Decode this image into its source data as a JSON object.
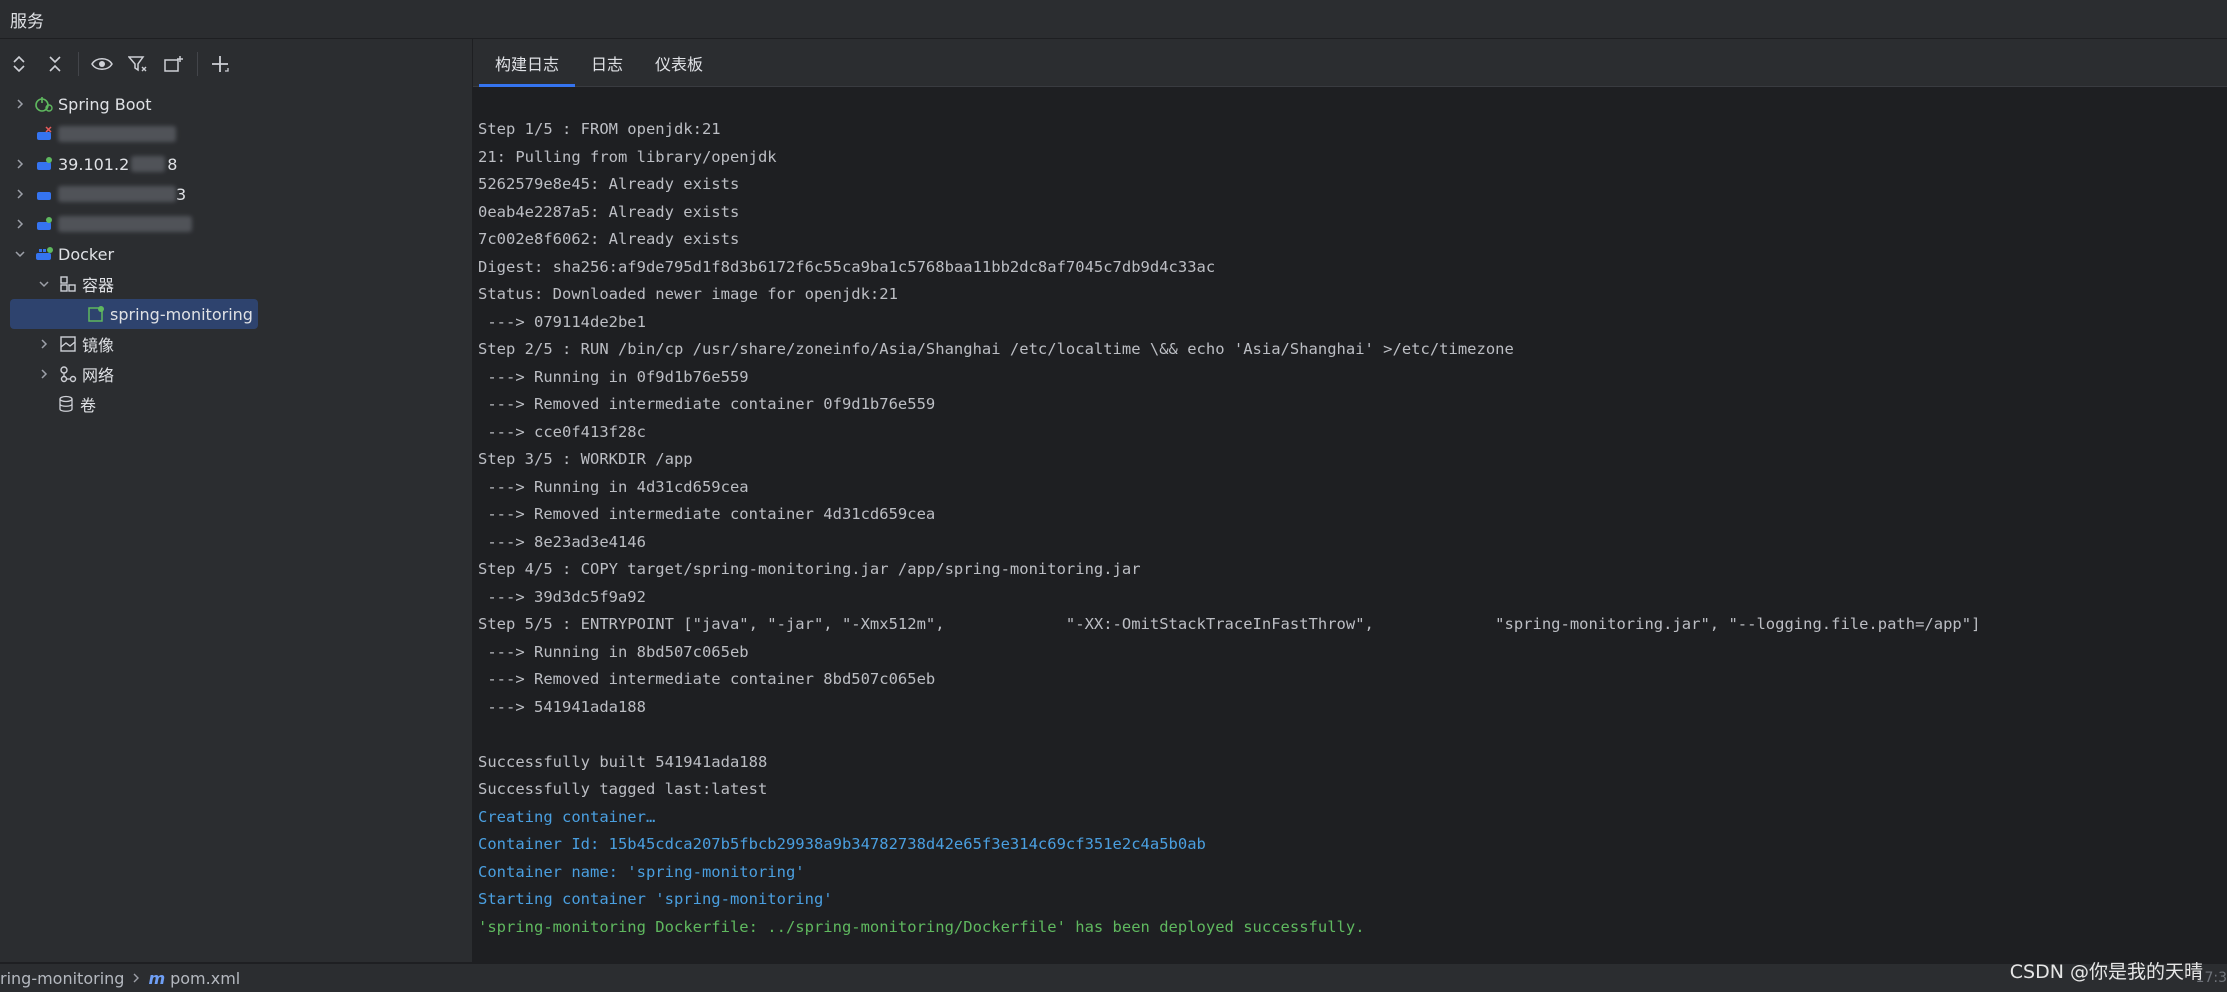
{
  "window": {
    "title": "服务"
  },
  "toolbar": {
    "buttons": [
      {
        "icon": "expand-all-icon",
        "glyph": "⌃"
      },
      {
        "icon": "collapse-all-icon",
        "glyph": "⌄"
      },
      {
        "icon": "eye-icon",
        "glyph": "◉"
      },
      {
        "icon": "filter-icon",
        "glyph": "⛉"
      },
      {
        "icon": "new-tab-icon",
        "glyph": "⧉"
      },
      {
        "icon": "add-icon",
        "glyph": "+"
      }
    ]
  },
  "tree": {
    "spring_boot": "Spring Boot",
    "docker": "Docker",
    "containers": "容器",
    "container_item": "spring-monitoring",
    "images": "镜像",
    "networks": "网络",
    "volumes": "卷",
    "server_partial_1": "39.101.2",
    "server_partial_1_suffix": "8",
    "server_partial_2_suffix": "3"
  },
  "tabs": [
    "构建日志",
    "日志",
    "仪表板"
  ],
  "log": {
    "lines": [
      "Step 1/5 : FROM openjdk:21",
      "21: Pulling from library/openjdk",
      "5262579e8e45: Already exists",
      "0eab4e2287a5: Already exists",
      "7c002e8f6062: Already exists",
      "Digest: sha256:af9de795d1f8d3b6172f6c55ca9ba1c5768baa11bb2dc8af7045c7db9d4c33ac",
      "Status: Downloaded newer image for openjdk:21",
      " ---> 079114de2be1",
      "Step 2/5 : RUN /bin/cp /usr/share/zoneinfo/Asia/Shanghai /etc/localtime \\&& echo 'Asia/Shanghai' >/etc/timezone",
      " ---> Running in 0f9d1b76e559",
      " ---> Removed intermediate container 0f9d1b76e559",
      " ---> cce0f413f28c",
      "Step 3/5 : WORKDIR /app",
      " ---> Running in 4d31cd659cea",
      " ---> Removed intermediate container 4d31cd659cea",
      " ---> 8e23ad3e4146",
      "Step 4/5 : COPY target/spring-monitoring.jar /app/spring-monitoring.jar",
      " ---> 39d3dc5f9a92",
      "Step 5/5 : ENTRYPOINT [\"java\", \"-jar\", \"-Xmx512m\",             \"-XX:-OmitStackTraceInFastThrow\",             \"spring-monitoring.jar\", \"--logging.file.path=/app\"]",
      " ---> Running in 8bd507c065eb",
      " ---> Removed intermediate container 8bd507c065eb",
      " ---> 541941ada188",
      "",
      "Successfully built 541941ada188",
      "Successfully tagged last:latest"
    ],
    "info_lines": [
      "Creating container…",
      "Container Id: 15b45cdca207b5fbcb29938a9b34782738d42e65f3e314c69cf351e2c4a5b0ab",
      "Container name: 'spring-monitoring'",
      "Starting container 'spring-monitoring'"
    ],
    "success_line": "'spring-monitoring Dockerfile: ../spring-monitoring/Dockerfile' has been deployed successfully."
  },
  "statusbar": {
    "crumb_project": "ring-monitoring",
    "crumb_file": "pom.xml",
    "position": "17:3",
    "watermark": "CSDN @你是我的天晴"
  },
  "colors": {
    "accent": "#3574f0",
    "info": "#4a9fe0",
    "success": "#5fb85f",
    "selection": "#2e436e"
  }
}
